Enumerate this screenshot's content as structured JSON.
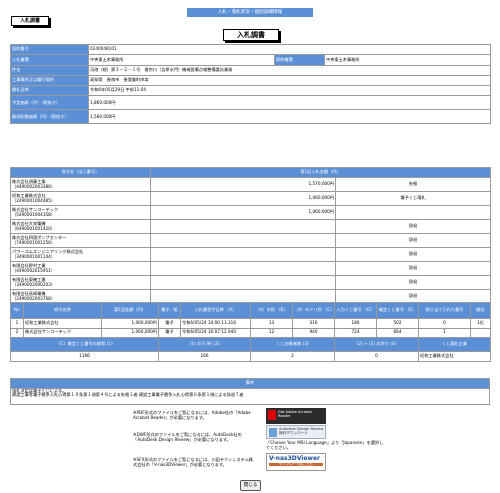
{
  "top_bar": "入札・落札状況・個別詳細情報",
  "tag": "入札調書",
  "page_title": "入札調書",
  "info": {
    "rows": [
      {
        "label": "契約番号",
        "value": "0240048101"
      },
      {
        "label": "入札機関",
        "value": "中央東土木事務所",
        "label2": "契約機関",
        "value2": "中央東土木事務所"
      },
      {
        "label": "件名",
        "value": "河改（総）第３－２－１号　香宗川（吉原水門）機械設備点検整備委託業務"
      },
      {
        "label": "工事場所又は履行場所",
        "value": "高知県　香南市　香我美町岸本"
      },
      {
        "label": "開札日時",
        "value": "令和6年05月29日 午前11:04"
      },
      {
        "label": "予定価格（円）（税抜き）",
        "value": "1,860,000円"
      },
      {
        "label": "最低制限価格（円）（税抜き）",
        "value": "1,580,000円"
      }
    ]
  },
  "bidders": {
    "header_name": "商号名（法人番号）",
    "header_amount": "第1回入札金額（円）",
    "rows": [
      {
        "name": "株式会社須藤工業",
        "id": "（4490002003386）",
        "amount": "1,570,000円",
        "note": "失格"
      },
      {
        "name": "紀和工業株式会社",
        "id": "（2490001004485）",
        "amount": "1,060,000円",
        "note": "電子くじ落札"
      },
      {
        "name": "株式会社サンコーテック",
        "id": "（5490001004358）",
        "amount": "1,060,000円",
        "note": ""
      },
      {
        "name": "株式会社大栄電機",
        "id": "（6490001001420）",
        "amount": "",
        "note": "辞退"
      },
      {
        "name": "株式会社四国ボンプセンター",
        "id": "（7490001001256）",
        "amount": "",
        "note": "辞退"
      },
      {
        "name": "パワーコムエンジニアリング株式会社",
        "id": "（3490001001144）",
        "amount": "",
        "note": "辞退"
      },
      {
        "name": "有限会社野村工業",
        "id": "（4490002015951）",
        "amount": "",
        "note": "辞退"
      },
      {
        "name": "有限会社東機工業",
        "id": "（3490002000203）",
        "amount": "",
        "note": "辞退"
      },
      {
        "name": "有限会社長崎電機",
        "id": "（2490002003768）",
        "amount": "",
        "note": "辞退"
      },
      {
        "name": "荒川電工株式会社",
        "id": "（8490001000761）",
        "amount": "",
        "note": ""
      }
    ]
  },
  "lottery": {
    "headers": [
      "No",
      "商号名称",
      "第1回金額（円）",
      "電子／紙",
      "入札書受付日時\n（A）",
      "（A）の秒\n（B）",
      "（A）のミリ秒\n（C）",
      "入力くじ番号\n（D）",
      "確定くじ番号\n（E）",
      "割り当てられた番号",
      "順位"
    ],
    "rows": [
      {
        "no": "1",
        "name": "紀和工業株式会社",
        "amount": "1,060,000円",
        "type": "電子",
        "datetime": "令和6/05/24 10:00:13.316",
        "sec": "13",
        "msec": "316",
        "input": "186",
        "fixed": "502",
        "assigned": "0",
        "rank": "1位"
      },
      {
        "no": "2",
        "name": "株式会社サンコーテック",
        "amount": "1,060,000円",
        "type": "電子",
        "datetime": "令和6/05/24 16:07:12.940",
        "sec": "12",
        "msec": "940",
        "input": "724",
        "fixed": "664",
        "assigned": "1",
        "rank": ""
      }
    ],
    "summary_headers": [
      "（C）確定くじ番号の総和\n(1)",
      "(1) の下3桁\n(2)",
      "くじ対象者数\n(3)",
      "(2) ÷ (3) の余り\n(4)",
      "くじ落札企業"
    ],
    "summary": [
      "1166",
      "166",
      "2",
      "0",
      "紀和工業株式会社"
    ]
  },
  "remarks": {
    "header": "備考",
    "line1": "落札決定は電子くじによる。",
    "line2": "建設工事等電子競争入札心得第１０条第１項第４号による失格１者 建設工事電子競争入札心得第８条第１項による辞退７者"
  },
  "notes": {
    "pdf": "※PDF形式のファイルをご覧になるには、Adobe社の「Adobe Acrobat Reader」が必要になります。",
    "dwf": "※DWF形式のファイルをご覧になるには、AutoDesk社の「AutoDesk Design Review」が必要になります。",
    "sfx": "※SFX形式のファイルをご覧になるには、川田テクノシステム株式会社の「V-nas3DViewer」が必要となります。",
    "dwf_side": "「Choose Your MSI Language」より「Japanese」を選択してください。"
  },
  "badges": {
    "adobe": "Get Adobe Acrobat Reader",
    "autodesk": "Autodesk Design Review 無料ダウンロード",
    "vnas": "V-nas3DViewer",
    "vnas_sub": "ダウンロードはこちら"
  },
  "close_button": "閉じる"
}
